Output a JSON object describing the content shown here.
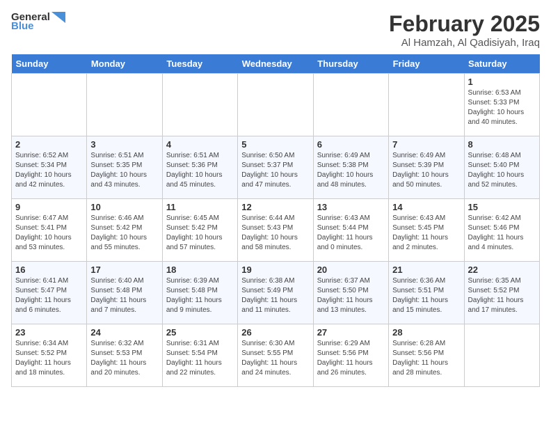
{
  "logo": {
    "line1": "General",
    "line2": "Blue"
  },
  "title": "February 2025",
  "subtitle": "Al Hamzah, Al Qadisiyah, Iraq",
  "days_of_week": [
    "Sunday",
    "Monday",
    "Tuesday",
    "Wednesday",
    "Thursday",
    "Friday",
    "Saturday"
  ],
  "weeks": [
    [
      {
        "day": "",
        "text": ""
      },
      {
        "day": "",
        "text": ""
      },
      {
        "day": "",
        "text": ""
      },
      {
        "day": "",
        "text": ""
      },
      {
        "day": "",
        "text": ""
      },
      {
        "day": "",
        "text": ""
      },
      {
        "day": "1",
        "text": "Sunrise: 6:53 AM\nSunset: 5:33 PM\nDaylight: 10 hours\nand 40 minutes."
      }
    ],
    [
      {
        "day": "2",
        "text": "Sunrise: 6:52 AM\nSunset: 5:34 PM\nDaylight: 10 hours\nand 42 minutes."
      },
      {
        "day": "3",
        "text": "Sunrise: 6:51 AM\nSunset: 5:35 PM\nDaylight: 10 hours\nand 43 minutes."
      },
      {
        "day": "4",
        "text": "Sunrise: 6:51 AM\nSunset: 5:36 PM\nDaylight: 10 hours\nand 45 minutes."
      },
      {
        "day": "5",
        "text": "Sunrise: 6:50 AM\nSunset: 5:37 PM\nDaylight: 10 hours\nand 47 minutes."
      },
      {
        "day": "6",
        "text": "Sunrise: 6:49 AM\nSunset: 5:38 PM\nDaylight: 10 hours\nand 48 minutes."
      },
      {
        "day": "7",
        "text": "Sunrise: 6:49 AM\nSunset: 5:39 PM\nDaylight: 10 hours\nand 50 minutes."
      },
      {
        "day": "8",
        "text": "Sunrise: 6:48 AM\nSunset: 5:40 PM\nDaylight: 10 hours\nand 52 minutes."
      }
    ],
    [
      {
        "day": "9",
        "text": "Sunrise: 6:47 AM\nSunset: 5:41 PM\nDaylight: 10 hours\nand 53 minutes."
      },
      {
        "day": "10",
        "text": "Sunrise: 6:46 AM\nSunset: 5:42 PM\nDaylight: 10 hours\nand 55 minutes."
      },
      {
        "day": "11",
        "text": "Sunrise: 6:45 AM\nSunset: 5:42 PM\nDaylight: 10 hours\nand 57 minutes."
      },
      {
        "day": "12",
        "text": "Sunrise: 6:44 AM\nSunset: 5:43 PM\nDaylight: 10 hours\nand 58 minutes."
      },
      {
        "day": "13",
        "text": "Sunrise: 6:43 AM\nSunset: 5:44 PM\nDaylight: 11 hours\nand 0 minutes."
      },
      {
        "day": "14",
        "text": "Sunrise: 6:43 AM\nSunset: 5:45 PM\nDaylight: 11 hours\nand 2 minutes."
      },
      {
        "day": "15",
        "text": "Sunrise: 6:42 AM\nSunset: 5:46 PM\nDaylight: 11 hours\nand 4 minutes."
      }
    ],
    [
      {
        "day": "16",
        "text": "Sunrise: 6:41 AM\nSunset: 5:47 PM\nDaylight: 11 hours\nand 6 minutes."
      },
      {
        "day": "17",
        "text": "Sunrise: 6:40 AM\nSunset: 5:48 PM\nDaylight: 11 hours\nand 7 minutes."
      },
      {
        "day": "18",
        "text": "Sunrise: 6:39 AM\nSunset: 5:48 PM\nDaylight: 11 hours\nand 9 minutes."
      },
      {
        "day": "19",
        "text": "Sunrise: 6:38 AM\nSunset: 5:49 PM\nDaylight: 11 hours\nand 11 minutes."
      },
      {
        "day": "20",
        "text": "Sunrise: 6:37 AM\nSunset: 5:50 PM\nDaylight: 11 hours\nand 13 minutes."
      },
      {
        "day": "21",
        "text": "Sunrise: 6:36 AM\nSunset: 5:51 PM\nDaylight: 11 hours\nand 15 minutes."
      },
      {
        "day": "22",
        "text": "Sunrise: 6:35 AM\nSunset: 5:52 PM\nDaylight: 11 hours\nand 17 minutes."
      }
    ],
    [
      {
        "day": "23",
        "text": "Sunrise: 6:34 AM\nSunset: 5:52 PM\nDaylight: 11 hours\nand 18 minutes."
      },
      {
        "day": "24",
        "text": "Sunrise: 6:32 AM\nSunset: 5:53 PM\nDaylight: 11 hours\nand 20 minutes."
      },
      {
        "day": "25",
        "text": "Sunrise: 6:31 AM\nSunset: 5:54 PM\nDaylight: 11 hours\nand 22 minutes."
      },
      {
        "day": "26",
        "text": "Sunrise: 6:30 AM\nSunset: 5:55 PM\nDaylight: 11 hours\nand 24 minutes."
      },
      {
        "day": "27",
        "text": "Sunrise: 6:29 AM\nSunset: 5:56 PM\nDaylight: 11 hours\nand 26 minutes."
      },
      {
        "day": "28",
        "text": "Sunrise: 6:28 AM\nSunset: 5:56 PM\nDaylight: 11 hours\nand 28 minutes."
      },
      {
        "day": "",
        "text": ""
      }
    ]
  ]
}
